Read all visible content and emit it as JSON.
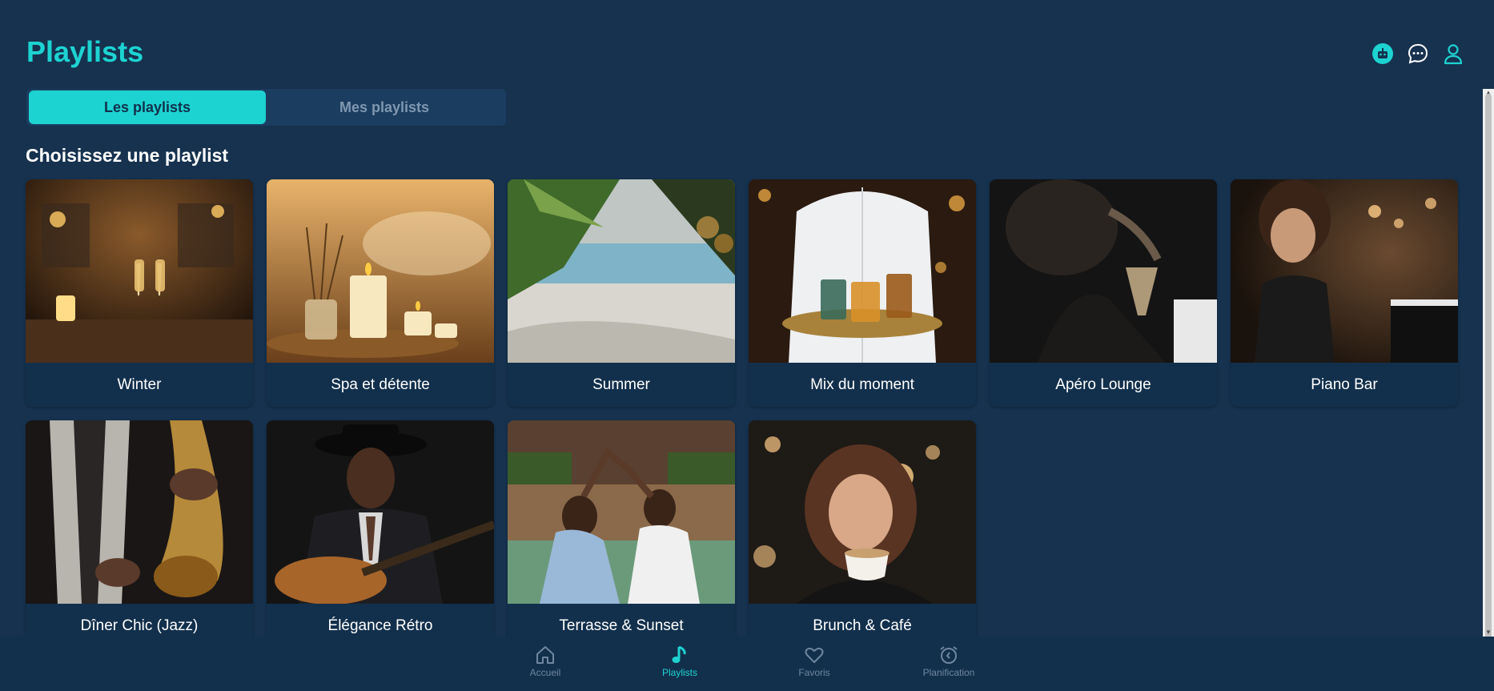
{
  "header": {
    "title": "Playlists",
    "icons": [
      "robot-icon",
      "chat-icon",
      "user-icon"
    ]
  },
  "tabs": [
    {
      "label": "Les playlists",
      "active": true
    },
    {
      "label": "Mes playlists",
      "active": false
    }
  ],
  "section": {
    "title": "Choisissez une playlist"
  },
  "playlists": [
    {
      "name": "Winter"
    },
    {
      "name": "Spa et détente"
    },
    {
      "name": "Summer"
    },
    {
      "name": "Mix du moment"
    },
    {
      "name": "Apéro Lounge"
    },
    {
      "name": "Piano Bar"
    },
    {
      "name": "Dîner Chic (Jazz)"
    },
    {
      "name": "Élégance Rétro"
    },
    {
      "name": "Terrasse & Sunset"
    },
    {
      "name": "Brunch & Café"
    }
  ],
  "bottom_nav": [
    {
      "label": "Accueil",
      "icon": "home-icon",
      "active": false
    },
    {
      "label": "Playlists",
      "icon": "music-note-icon",
      "active": true
    },
    {
      "label": "Favoris",
      "icon": "heart-icon",
      "active": false
    },
    {
      "label": "Planification",
      "icon": "alarm-clock-icon",
      "active": false
    }
  ],
  "colors": {
    "background": "#16324f",
    "accent": "#1dd3d1",
    "card": "#12304c",
    "inactive_text": "#7f97b0"
  }
}
